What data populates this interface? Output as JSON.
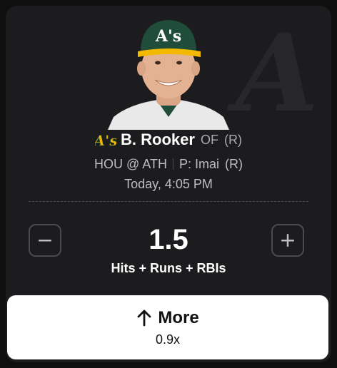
{
  "player": {
    "name": "B. Rooker",
    "position": "OF",
    "hand": "(R)",
    "team_logo": "athletics-logo"
  },
  "matchup": {
    "game": "HOU @ ATH",
    "pitcher": "P: Imai",
    "pitcher_hand": "(R)"
  },
  "time": "Today, 4:05 PM",
  "projection": {
    "line": "1.5",
    "stat": "Hits + Runs + RBIs"
  },
  "stepper": {
    "minus_icon": "minus-icon",
    "plus_icon": "plus-icon"
  },
  "pick": {
    "direction_icon": "arrow-up-icon",
    "label": "More",
    "multiplier": "0.9x"
  },
  "colors": {
    "card_bg": "#1c1c1e",
    "logo_green": "#1f4d3a",
    "logo_gold": "#f2b900",
    "button_bg": "#ffffff"
  }
}
